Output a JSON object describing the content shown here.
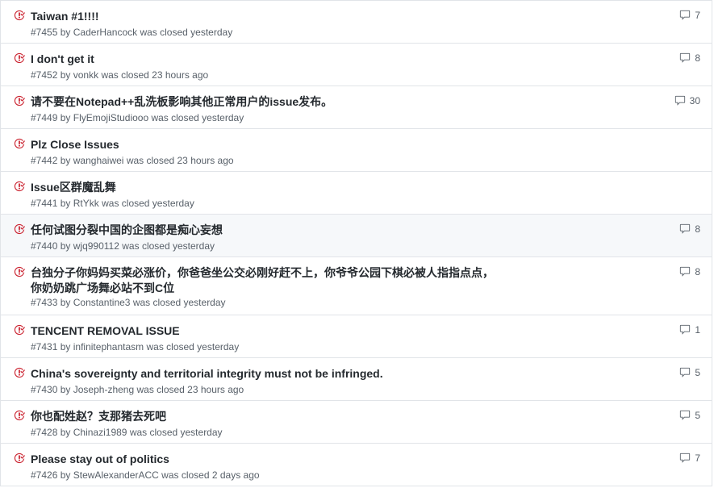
{
  "issues": [
    {
      "title": "Taiwan #1!!!!",
      "number": "#7455",
      "by": "by",
      "author": "CaderHancock",
      "status": "was closed yesterday",
      "comments": "7",
      "highlight": false
    },
    {
      "title": "I don't get it",
      "number": "#7452",
      "by": "by",
      "author": "vonkk",
      "status": "was closed 23 hours ago",
      "comments": "8",
      "highlight": false
    },
    {
      "title": "请不要在Notepad++乱洗板影响其他正常用户的issue发布。",
      "number": "#7449",
      "by": "by",
      "author": "FlyEmojiStudiooo",
      "status": "was closed yesterday",
      "comments": "30",
      "highlight": false
    },
    {
      "title": "Plz Close Issues",
      "number": "#7442",
      "by": "by",
      "author": "wanghaiwei",
      "status": "was closed 23 hours ago",
      "comments": "",
      "highlight": false
    },
    {
      "title": "Issue区群魔乱舞",
      "number": "#7441",
      "by": "by",
      "author": "RtYkk",
      "status": "was closed yesterday",
      "comments": "",
      "highlight": false
    },
    {
      "title": "任何试图分裂中国的企图都是痴心妄想",
      "number": "#7440",
      "by": "by",
      "author": "wjq990112",
      "status": "was closed yesterday",
      "comments": "8",
      "highlight": true
    },
    {
      "title": "台独分子你妈妈买菜必涨价，你爸爸坐公交必刚好赶不上，你爷爷公园下棋必被人指指点点，你奶奶跳广场舞必站不到C位",
      "number": "#7433",
      "by": "by",
      "author": "Constantine3",
      "status": "was closed yesterday",
      "comments": "8",
      "highlight": false
    },
    {
      "title": "TENCENT REMOVAL ISSUE",
      "number": "#7431",
      "by": "by",
      "author": "infinitephantasm",
      "status": "was closed yesterday",
      "comments": "1",
      "highlight": false
    },
    {
      "title": "China's sovereignty and territorial integrity must not be infringed.",
      "number": "#7430",
      "by": "by",
      "author": "Joseph-zheng",
      "status": "was closed 23 hours ago",
      "comments": "5",
      "highlight": false
    },
    {
      "title": "你也配姓赵？支那猪去死吧",
      "number": "#7428",
      "by": "by",
      "author": "Chinazi1989",
      "status": "was closed yesterday",
      "comments": "5",
      "highlight": false
    },
    {
      "title": "Please stay out of politics",
      "number": "#7426",
      "by": "by",
      "author": "StewAlexanderACC",
      "status": "was closed 2 days ago",
      "comments": "7",
      "highlight": false
    }
  ],
  "icons": {
    "state": "issue-closed-icon",
    "comments": "comment-icon"
  },
  "colors": {
    "closed": "#cb2431",
    "text": "#24292e",
    "muted": "#586069",
    "border": "#e1e4e8",
    "highlight": "#f6f8fa"
  }
}
